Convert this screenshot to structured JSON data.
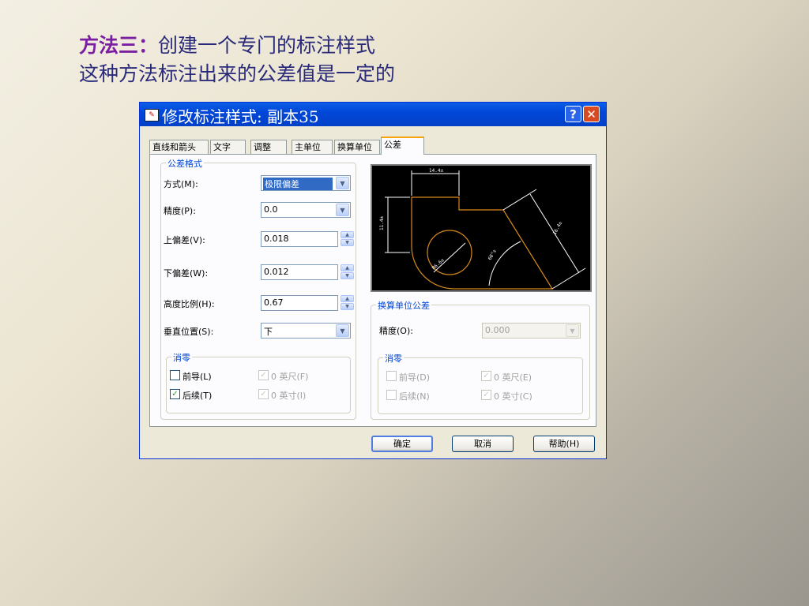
{
  "heading": {
    "line1_highlight": "方法三：",
    "line1_rest": "创建一个专门的标注样式",
    "line2": "这种方法标注出来的公差值是一定的"
  },
  "dialog": {
    "title": "修改标注样式: 副本35",
    "help_glyph": "?",
    "close_glyph": "✕",
    "app_icon_glyph": "✎"
  },
  "tabs": [
    {
      "label": "直线和箭头"
    },
    {
      "label": "文字"
    },
    {
      "label": "调整"
    },
    {
      "label": "主单位"
    },
    {
      "label": "换算单位"
    },
    {
      "label": "公差"
    }
  ],
  "tolerance_format": {
    "title": "公差格式",
    "method_label": "方式(M):",
    "method_value": "极限偏差",
    "precision_label": "精度(P):",
    "precision_value": "0.0",
    "upper_label": "上偏差(V):",
    "upper_value": "0.018",
    "lower_label": "下偏差(W):",
    "lower_value": "0.012",
    "height_label": "高度比例(H):",
    "height_value": "0.67",
    "vpos_label": "垂直位置(S):",
    "vpos_value": "下",
    "zero_suppression": {
      "title": "消零",
      "leading": "前导(L)",
      "leading_checked": false,
      "trailing": "后续(T)",
      "trailing_checked": true,
      "feet": "0 英尺(F)",
      "inches": "0 英寸(I)"
    }
  },
  "alt_unit_tolerance": {
    "title": "换算单位公差",
    "precision_label": "精度(O):",
    "precision_value": "0.000",
    "zero_suppression": {
      "title": "消零",
      "leading": "前导(D)",
      "trailing": "后续(N)",
      "feet": "0 英尺(E)",
      "inches": "0 英寸(C)"
    }
  },
  "buttons": {
    "ok": "确定",
    "cancel": "取消",
    "help": "帮助(H)"
  },
  "colors": {
    "titlebar": "#0247d8",
    "preview_bg": "#000000",
    "preview_geometry": "#d98a1a",
    "preview_dimension": "#ffffff"
  }
}
